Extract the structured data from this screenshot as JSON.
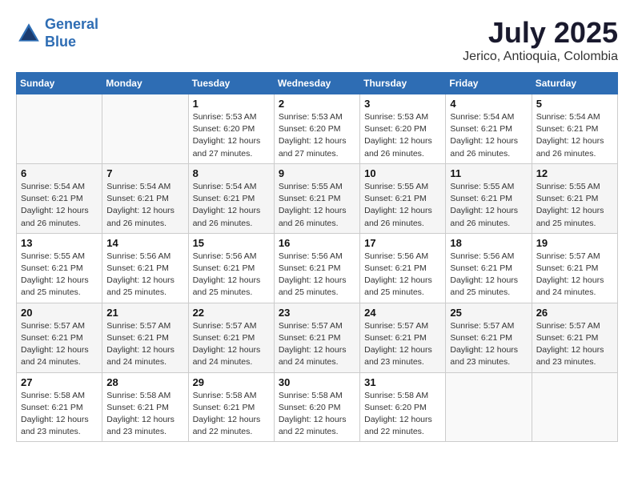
{
  "header": {
    "logo_line1": "General",
    "logo_line2": "Blue",
    "month": "July 2025",
    "location": "Jerico, Antioquia, Colombia"
  },
  "weekdays": [
    "Sunday",
    "Monday",
    "Tuesday",
    "Wednesday",
    "Thursday",
    "Friday",
    "Saturday"
  ],
  "weeks": [
    [
      {
        "day": "",
        "info": ""
      },
      {
        "day": "",
        "info": ""
      },
      {
        "day": "1",
        "info": "Sunrise: 5:53 AM\nSunset: 6:20 PM\nDaylight: 12 hours\nand 27 minutes."
      },
      {
        "day": "2",
        "info": "Sunrise: 5:53 AM\nSunset: 6:20 PM\nDaylight: 12 hours\nand 27 minutes."
      },
      {
        "day": "3",
        "info": "Sunrise: 5:53 AM\nSunset: 6:20 PM\nDaylight: 12 hours\nand 26 minutes."
      },
      {
        "day": "4",
        "info": "Sunrise: 5:54 AM\nSunset: 6:21 PM\nDaylight: 12 hours\nand 26 minutes."
      },
      {
        "day": "5",
        "info": "Sunrise: 5:54 AM\nSunset: 6:21 PM\nDaylight: 12 hours\nand 26 minutes."
      }
    ],
    [
      {
        "day": "6",
        "info": "Sunrise: 5:54 AM\nSunset: 6:21 PM\nDaylight: 12 hours\nand 26 minutes."
      },
      {
        "day": "7",
        "info": "Sunrise: 5:54 AM\nSunset: 6:21 PM\nDaylight: 12 hours\nand 26 minutes."
      },
      {
        "day": "8",
        "info": "Sunrise: 5:54 AM\nSunset: 6:21 PM\nDaylight: 12 hours\nand 26 minutes."
      },
      {
        "day": "9",
        "info": "Sunrise: 5:55 AM\nSunset: 6:21 PM\nDaylight: 12 hours\nand 26 minutes."
      },
      {
        "day": "10",
        "info": "Sunrise: 5:55 AM\nSunset: 6:21 PM\nDaylight: 12 hours\nand 26 minutes."
      },
      {
        "day": "11",
        "info": "Sunrise: 5:55 AM\nSunset: 6:21 PM\nDaylight: 12 hours\nand 26 minutes."
      },
      {
        "day": "12",
        "info": "Sunrise: 5:55 AM\nSunset: 6:21 PM\nDaylight: 12 hours\nand 25 minutes."
      }
    ],
    [
      {
        "day": "13",
        "info": "Sunrise: 5:55 AM\nSunset: 6:21 PM\nDaylight: 12 hours\nand 25 minutes."
      },
      {
        "day": "14",
        "info": "Sunrise: 5:56 AM\nSunset: 6:21 PM\nDaylight: 12 hours\nand 25 minutes."
      },
      {
        "day": "15",
        "info": "Sunrise: 5:56 AM\nSunset: 6:21 PM\nDaylight: 12 hours\nand 25 minutes."
      },
      {
        "day": "16",
        "info": "Sunrise: 5:56 AM\nSunset: 6:21 PM\nDaylight: 12 hours\nand 25 minutes."
      },
      {
        "day": "17",
        "info": "Sunrise: 5:56 AM\nSunset: 6:21 PM\nDaylight: 12 hours\nand 25 minutes."
      },
      {
        "day": "18",
        "info": "Sunrise: 5:56 AM\nSunset: 6:21 PM\nDaylight: 12 hours\nand 25 minutes."
      },
      {
        "day": "19",
        "info": "Sunrise: 5:57 AM\nSunset: 6:21 PM\nDaylight: 12 hours\nand 24 minutes."
      }
    ],
    [
      {
        "day": "20",
        "info": "Sunrise: 5:57 AM\nSunset: 6:21 PM\nDaylight: 12 hours\nand 24 minutes."
      },
      {
        "day": "21",
        "info": "Sunrise: 5:57 AM\nSunset: 6:21 PM\nDaylight: 12 hours\nand 24 minutes."
      },
      {
        "day": "22",
        "info": "Sunrise: 5:57 AM\nSunset: 6:21 PM\nDaylight: 12 hours\nand 24 minutes."
      },
      {
        "day": "23",
        "info": "Sunrise: 5:57 AM\nSunset: 6:21 PM\nDaylight: 12 hours\nand 24 minutes."
      },
      {
        "day": "24",
        "info": "Sunrise: 5:57 AM\nSunset: 6:21 PM\nDaylight: 12 hours\nand 23 minutes."
      },
      {
        "day": "25",
        "info": "Sunrise: 5:57 AM\nSunset: 6:21 PM\nDaylight: 12 hours\nand 23 minutes."
      },
      {
        "day": "26",
        "info": "Sunrise: 5:57 AM\nSunset: 6:21 PM\nDaylight: 12 hours\nand 23 minutes."
      }
    ],
    [
      {
        "day": "27",
        "info": "Sunrise: 5:58 AM\nSunset: 6:21 PM\nDaylight: 12 hours\nand 23 minutes."
      },
      {
        "day": "28",
        "info": "Sunrise: 5:58 AM\nSunset: 6:21 PM\nDaylight: 12 hours\nand 23 minutes."
      },
      {
        "day": "29",
        "info": "Sunrise: 5:58 AM\nSunset: 6:21 PM\nDaylight: 12 hours\nand 22 minutes."
      },
      {
        "day": "30",
        "info": "Sunrise: 5:58 AM\nSunset: 6:20 PM\nDaylight: 12 hours\nand 22 minutes."
      },
      {
        "day": "31",
        "info": "Sunrise: 5:58 AM\nSunset: 6:20 PM\nDaylight: 12 hours\nand 22 minutes."
      },
      {
        "day": "",
        "info": ""
      },
      {
        "day": "",
        "info": ""
      }
    ]
  ]
}
